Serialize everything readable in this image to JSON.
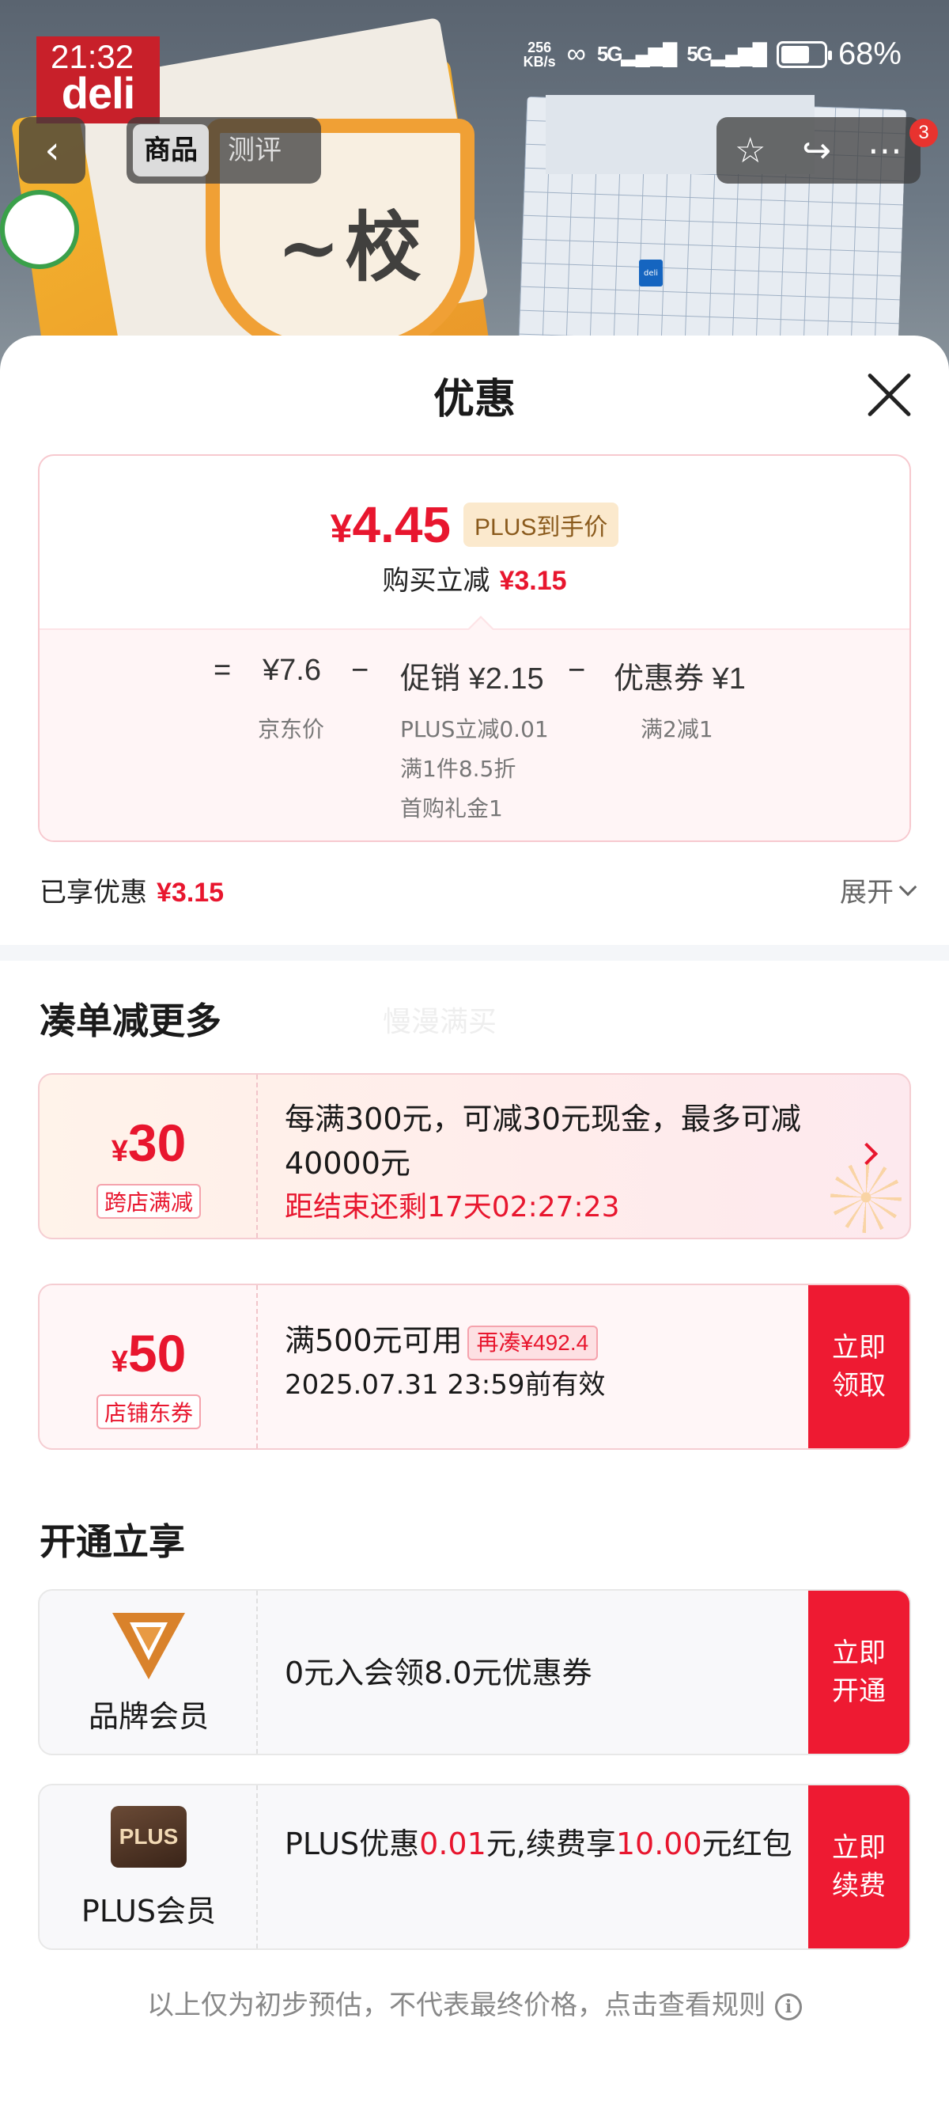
{
  "status_bar": {
    "time": "21:32",
    "net_speed_top": "256",
    "net_speed_unit": "KB/s",
    "signal1": "5G",
    "signal2": "5G",
    "battery": "68%",
    "battery_level": 0.68
  },
  "hero": {
    "brand_logo_text": "deli",
    "nav_tabs": [
      "商品",
      "测评"
    ],
    "active_tab": "商品",
    "notification_count": "3"
  },
  "sheet": {
    "title": "优惠",
    "price_card": {
      "final_price_symbol": "¥",
      "final_price": "4.45",
      "plus_tag": "PLUS到手价",
      "subtitle_label": "购买立减",
      "subtitle_amount": "¥3.15",
      "formula": {
        "eq": "=",
        "jd_price": "¥7.6",
        "minus1": "−",
        "promo": "促销 ¥2.15",
        "minus2": "−",
        "coupon": "优惠券 ¥1",
        "jd_price_label": "京东价",
        "promo_details": [
          "PLUS立减0.01",
          "满1件8.5折",
          "首购礼金1"
        ],
        "coupon_detail": "满2减1"
      }
    },
    "enjoyed_label": "已享优惠",
    "enjoyed_amount": "¥3.15",
    "expand_label": "展开",
    "section_more": "凑单减更多",
    "ghost_text": "慢漫满买",
    "coupons": [
      {
        "symbol": "¥",
        "amount": "30",
        "tag": "跨店满减",
        "line1": "每满300元，可减30元现金，最多可减40000元",
        "countdown": "距结束还剩17天02:27:23"
      },
      {
        "symbol": "¥",
        "amount": "50",
        "tag": "店铺东券",
        "line1": "满500元可用",
        "extra_tag": "再凑¥492.4",
        "line2": "2025.07.31 23:59前有效",
        "action": "立即领取"
      }
    ],
    "section_member": "开通立享",
    "members": [
      {
        "name": "品牌会员",
        "desc": "0元入会领8.0元优惠券",
        "action": "立即开通",
        "logo_color": "#d9822b"
      },
      {
        "name": "PLUS会员",
        "logo_text": "PLUS",
        "desc_prefix": "PLUS优惠",
        "desc_val1": "0.01",
        "desc_mid": "元,续费享",
        "desc_val2": "10.00",
        "desc_suffix": "元红包",
        "action": "立即续费"
      }
    ],
    "footer_note": "以上仅为初步预估，不代表最终价格，点击查看规则"
  },
  "colors": {
    "accent_red": "#e8162e",
    "button_red": "#ee1a32",
    "plus_tag_bg": "#fbe9cd"
  }
}
